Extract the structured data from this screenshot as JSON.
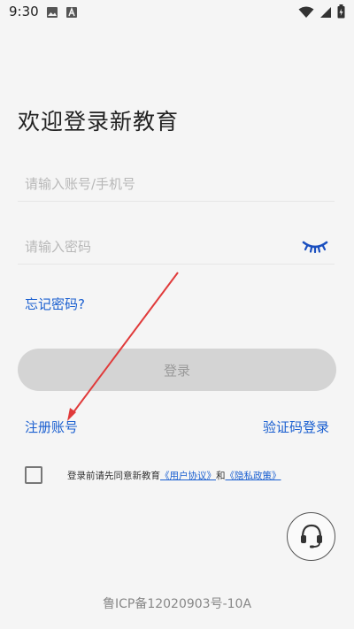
{
  "status_bar": {
    "time": "9:30",
    "icons_left": [
      "image-icon",
      "a-badge-icon"
    ],
    "icons_right": [
      "wifi-icon",
      "signal-icon",
      "battery-icon"
    ]
  },
  "title": "欢迎登录新教育",
  "account_field": {
    "placeholder": "请输入账号/手机号",
    "value": ""
  },
  "password_field": {
    "placeholder": "请输入密码",
    "value": "",
    "toggle_icon": "eye-closed-icon"
  },
  "forgot_password": "忘记密码?",
  "login_button": "登录",
  "register_link": "注册账号",
  "sms_login_link": "验证码登录",
  "agreement": {
    "checked": false,
    "prefix": "登录前请先同意新教育",
    "user_agreement": "《用户协议》",
    "and": "和",
    "privacy_policy": "《隐私政策》"
  },
  "support_icon": "headset-icon",
  "icp": "鲁ICP备12020903号-10A",
  "colors": {
    "background": "#f5f5f5",
    "link": "#1a5fd0",
    "button_disabled": "#d4d4d4",
    "annotation_arrow": "#e03a3a"
  }
}
